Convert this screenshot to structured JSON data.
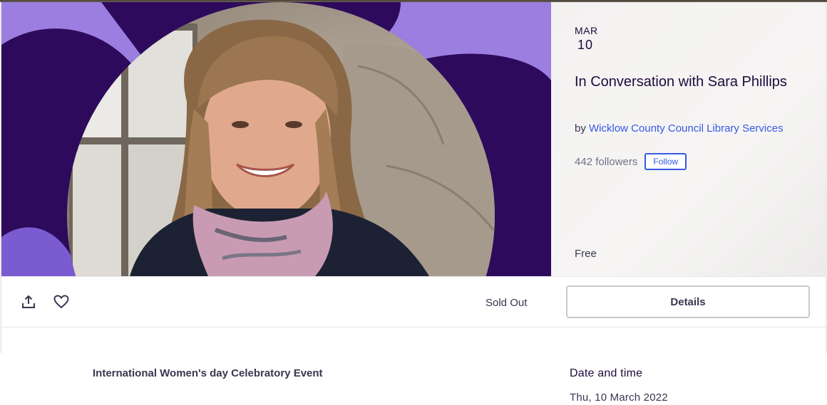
{
  "event": {
    "month": "MAR",
    "day": "10",
    "title": "In Conversation with Sara Phillips",
    "by_prefix": "by ",
    "organizer": "Wicklow County Council Library Services",
    "followers": "442 followers",
    "follow_label": "Follow",
    "price": "Free"
  },
  "actions": {
    "share_icon": "share-icon",
    "like_icon": "heart-icon",
    "status": "Sold Out",
    "details_label": "Details"
  },
  "details": {
    "summary": "International Women's day Celebratory Event",
    "date_heading": "Date and time",
    "date_value": "Thu, 10 March 2022"
  },
  "colors": {
    "purple_bg": "#9b7ee0",
    "dark_purple": "#2e0a5c",
    "link_blue": "#3659e3",
    "text_dark": "#1e0a3c"
  }
}
